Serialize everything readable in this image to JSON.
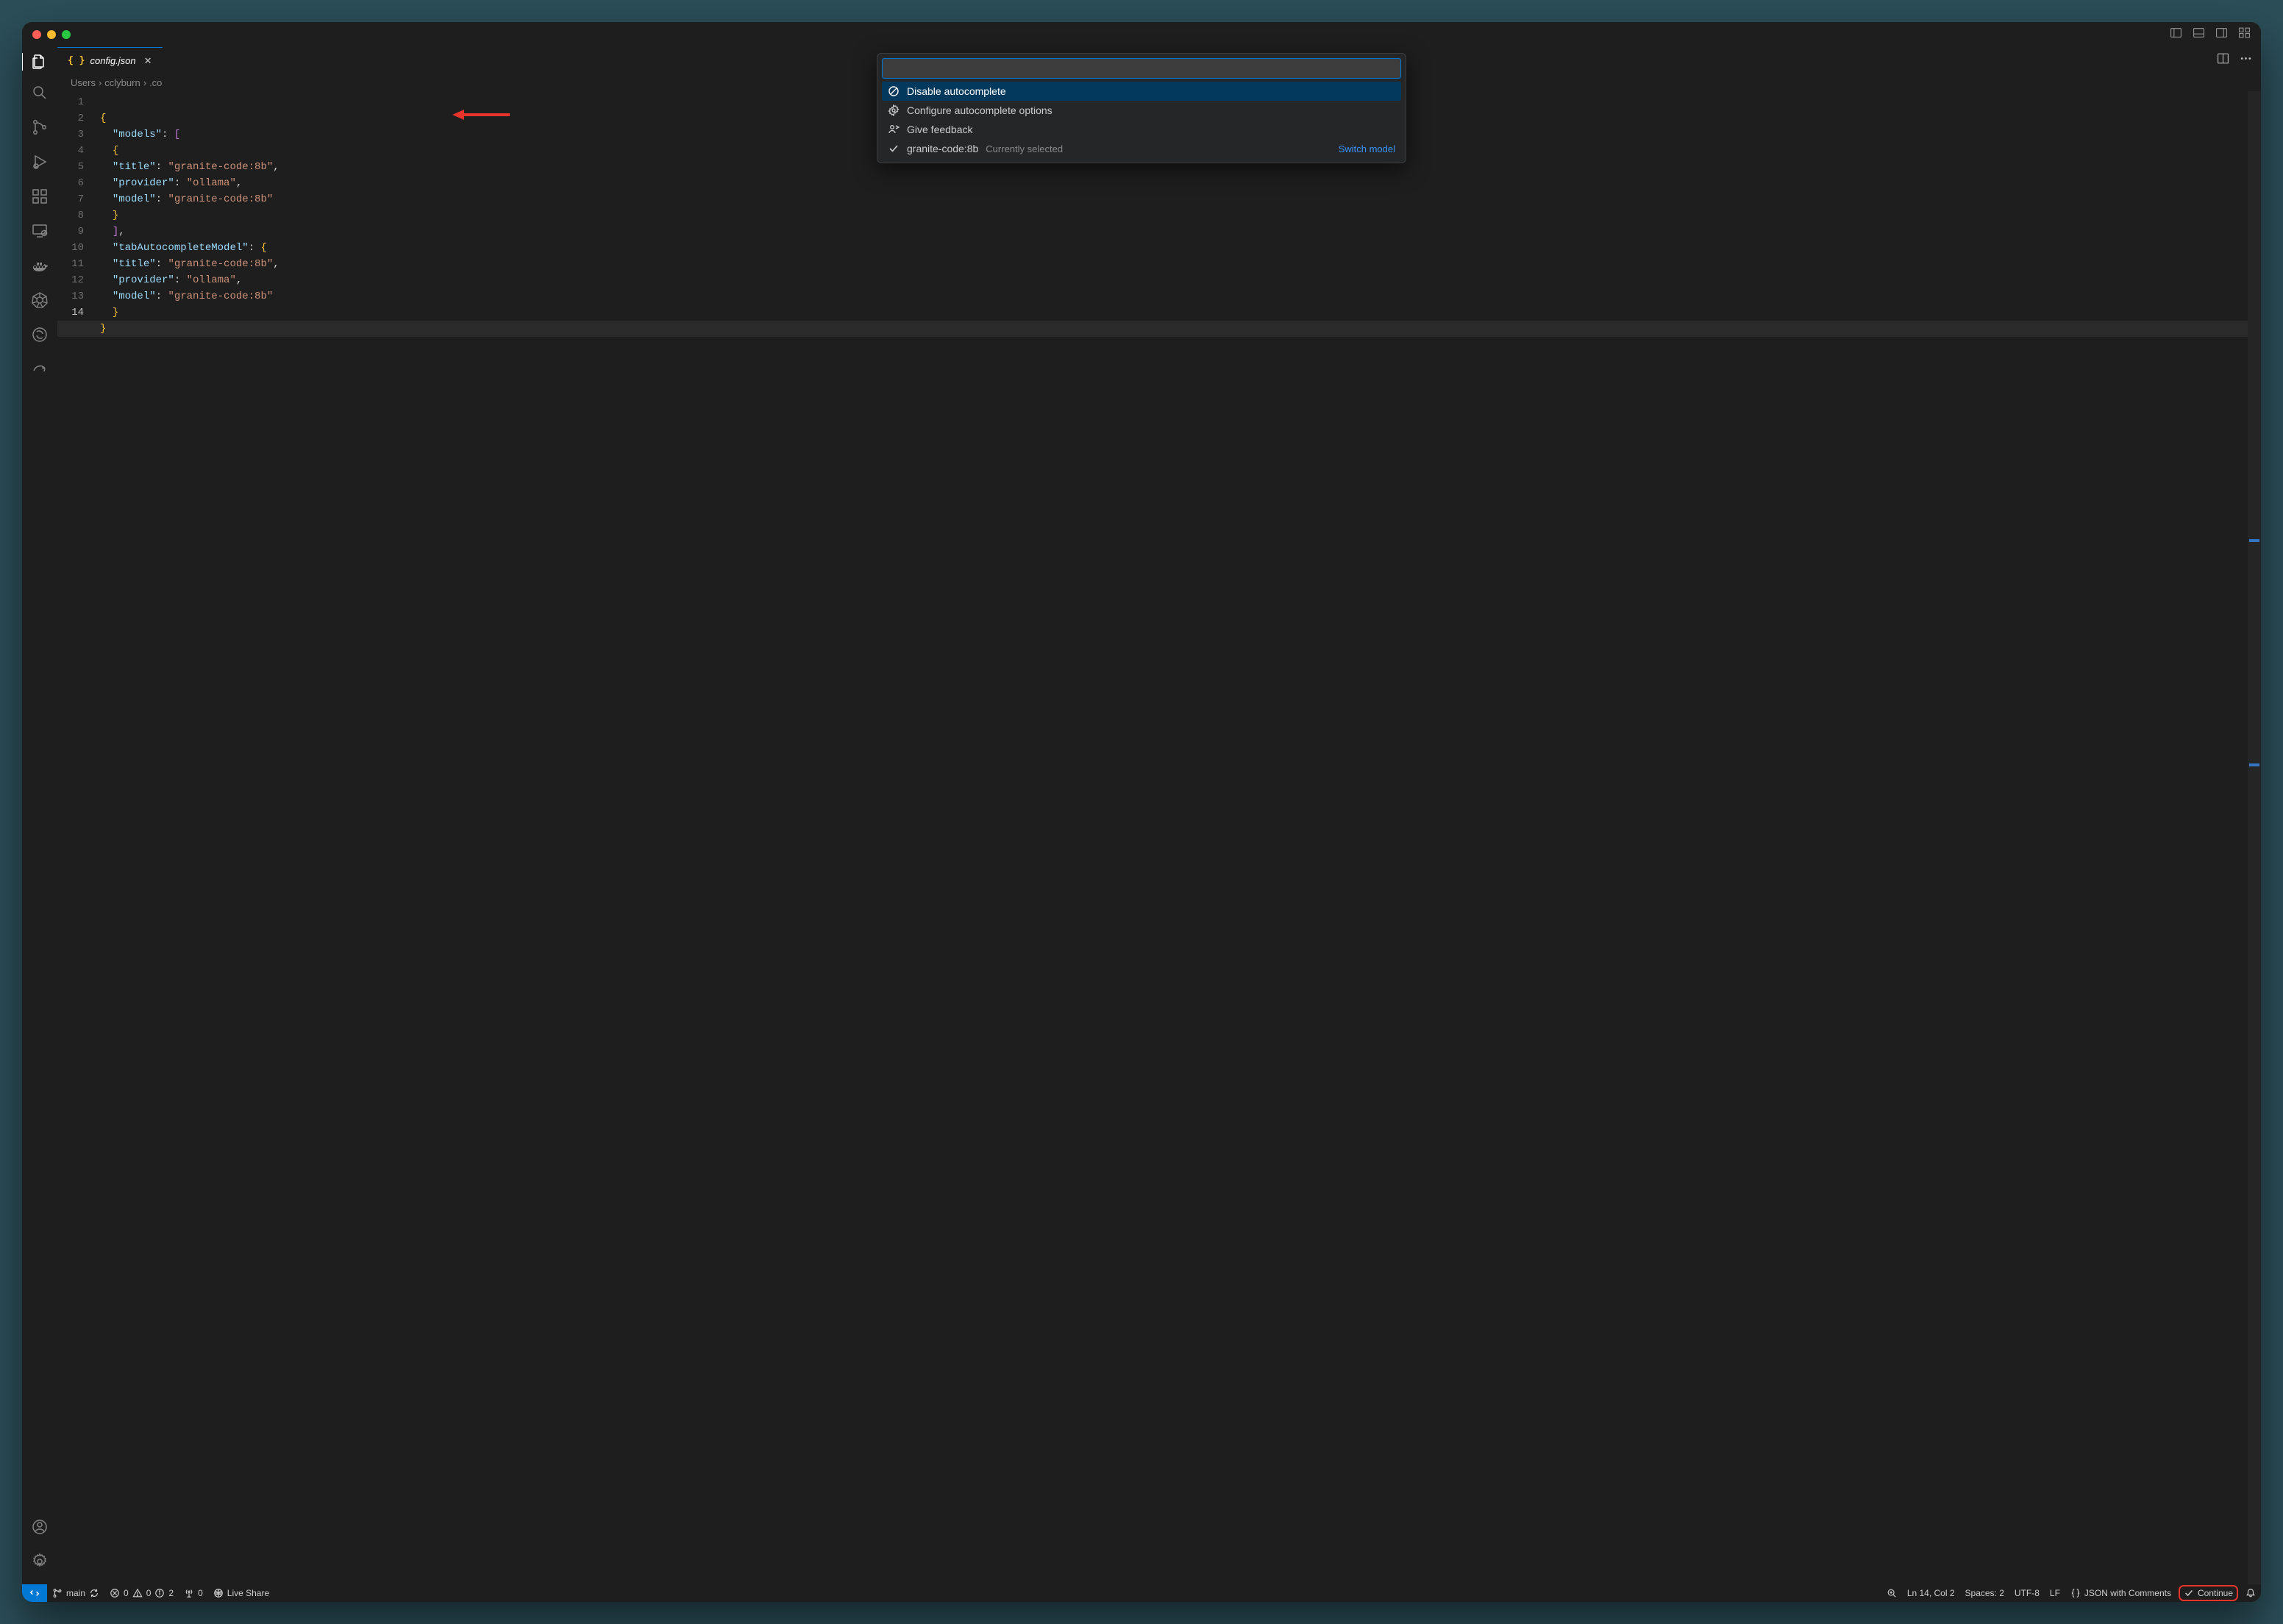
{
  "tab": {
    "filename": "config.json"
  },
  "breadcrumb": {
    "seg1": "Users",
    "seg2": "cclyburn",
    "seg3": ".co"
  },
  "gutter": [
    "1",
    "2",
    "3",
    "4",
    "5",
    "6",
    "7",
    "8",
    "9",
    "10",
    "11",
    "12",
    "13",
    "14"
  ],
  "code": {
    "l2_key": "\"models\"",
    "l4_key": "\"title\"",
    "l4_val": "\"granite-code:8b\"",
    "l5_key": "\"provider\"",
    "l5_val": "\"ollama\"",
    "l6_key": "\"model\"",
    "l6_val": "\"granite-code:8b\"",
    "l9_key": "\"tabAutocompleteModel\"",
    "l10_key": "\"title\"",
    "l10_val": "\"granite-code:8b\"",
    "l11_key": "\"provider\"",
    "l11_val": "\"ollama\"",
    "l12_key": "\"model\"",
    "l12_val": "\"granite-code:8b\""
  },
  "quickinput": {
    "items": [
      {
        "label": "Disable autocomplete"
      },
      {
        "label": "Configure autocomplete options"
      },
      {
        "label": "Give feedback"
      },
      {
        "label": "granite-code:8b",
        "hint": "Currently selected",
        "right": "Switch model"
      }
    ]
  },
  "status": {
    "branch": "main",
    "errors": "0",
    "warnings": "0",
    "info": "2",
    "ports": "0",
    "liveshare": "Live Share",
    "cursor": "Ln 14, Col 2",
    "spaces": "Spaces: 2",
    "encoding": "UTF-8",
    "eol": "LF",
    "language": "JSON with Comments",
    "continue": "Continue"
  }
}
